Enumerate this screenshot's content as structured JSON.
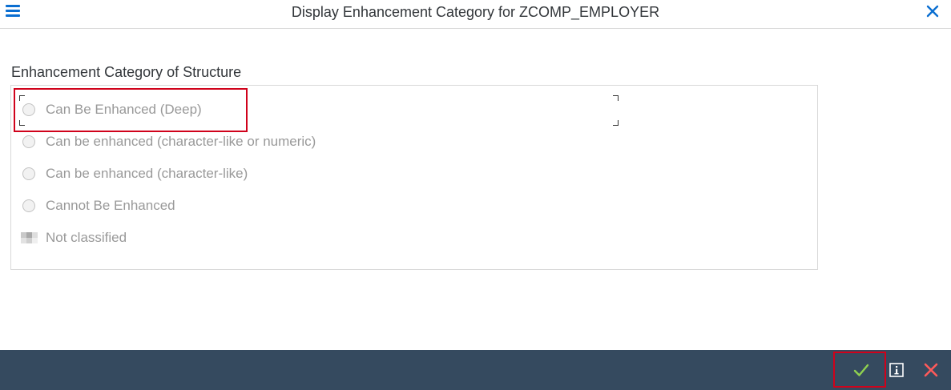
{
  "window": {
    "title": "Display Enhancement Category for ZCOMP_EMPLOYER"
  },
  "group": {
    "label": "Enhancement Category of Structure",
    "options": [
      {
        "label": "Can Be Enhanced (Deep)",
        "selected": false,
        "enabled": false
      },
      {
        "label": "Can be enhanced (character-like or numeric)",
        "selected": false,
        "enabled": false
      },
      {
        "label": "Can be enhanced (character-like)",
        "selected": false,
        "enabled": false
      },
      {
        "label": "Cannot Be Enhanced",
        "selected": false,
        "enabled": false
      },
      {
        "label": "Not classified",
        "selected": true,
        "enabled": false
      }
    ]
  },
  "footer": {
    "buttons": [
      {
        "icon": "checkmark-icon"
      },
      {
        "icon": "info-icon"
      },
      {
        "icon": "cancel-icon"
      }
    ]
  },
  "colors": {
    "accent": "#0a6ed1",
    "footer_bg": "#354a5f",
    "highlight": "#d0021b",
    "disabled_text": "#999999",
    "confirm_green": "#8fd14f",
    "cancel_red": "#ff5a5a"
  }
}
